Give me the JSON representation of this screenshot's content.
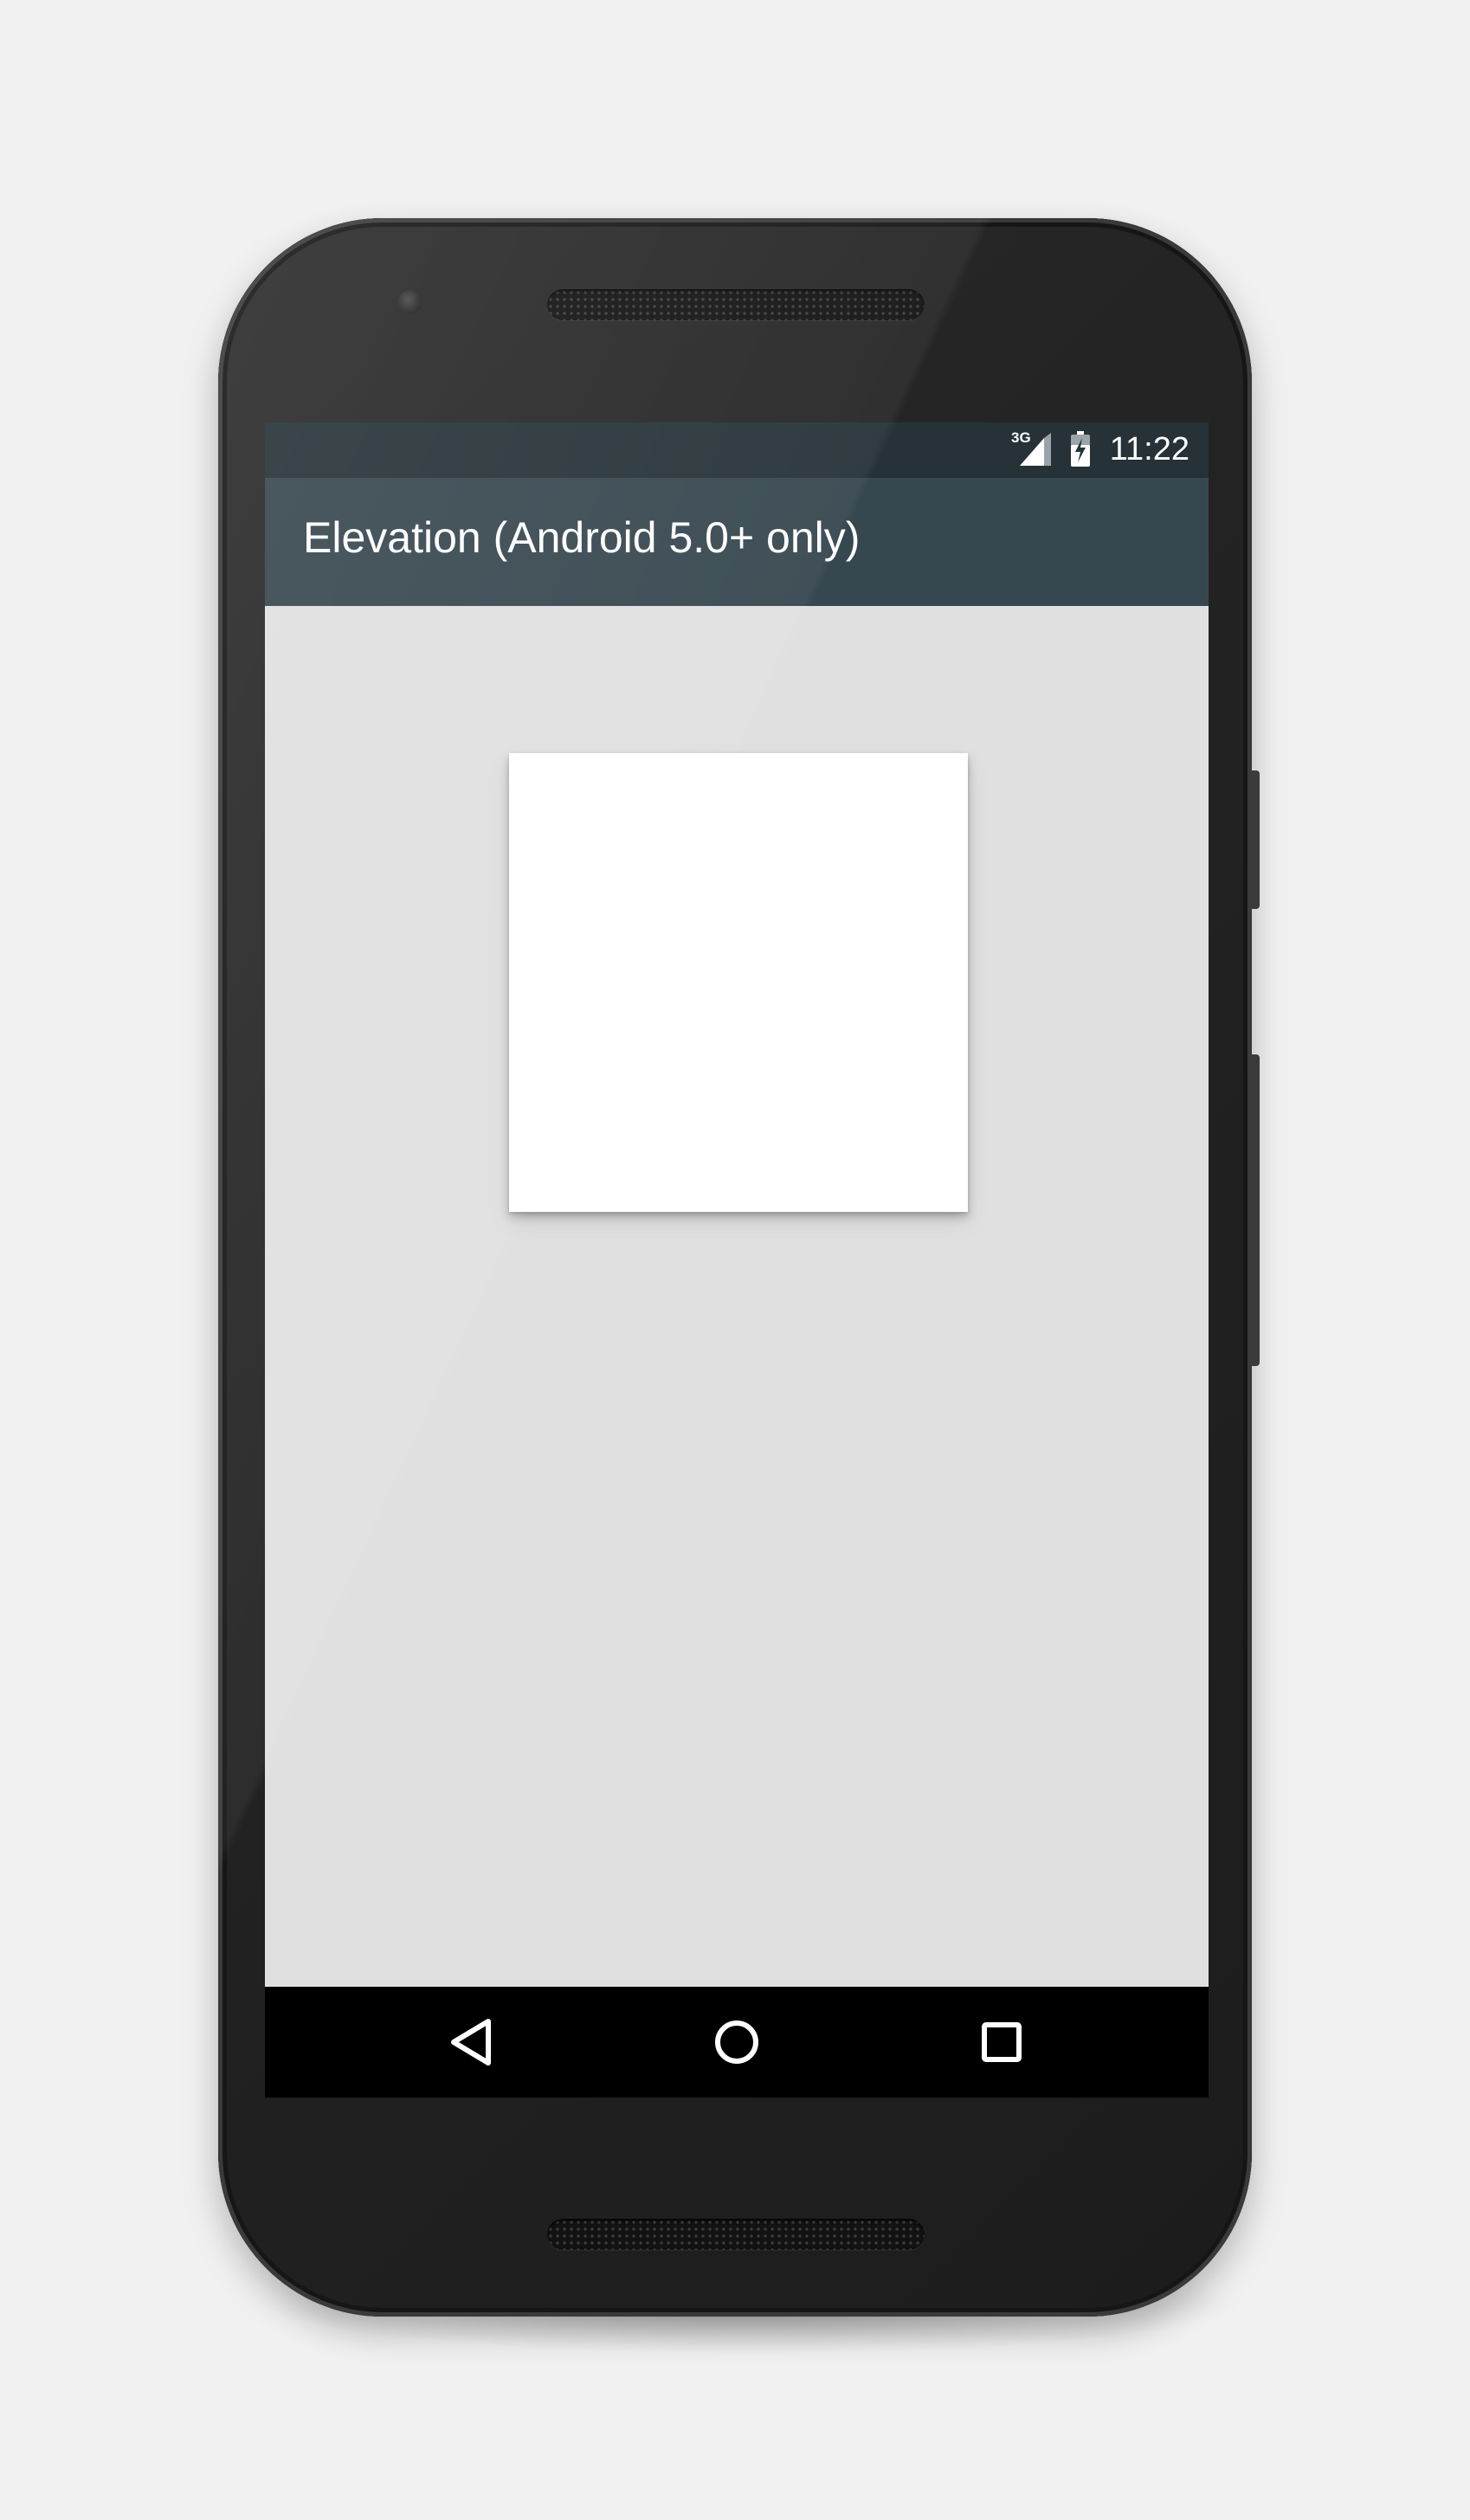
{
  "status_bar": {
    "network_type": "3G",
    "time": "11:22"
  },
  "app_bar": {
    "title": "Elevation (Android 5.0+ only)"
  },
  "colors": {
    "status_bar": "#263238",
    "app_bar": "#37474f",
    "content_background": "#e0e0e0",
    "elevated_card": "#ffffff",
    "navigation_bar": "#000000"
  },
  "navigation_bar": {
    "buttons": [
      {
        "icon": "back-triangle-icon"
      },
      {
        "icon": "home-circle-icon"
      },
      {
        "icon": "recents-square-icon"
      }
    ]
  }
}
